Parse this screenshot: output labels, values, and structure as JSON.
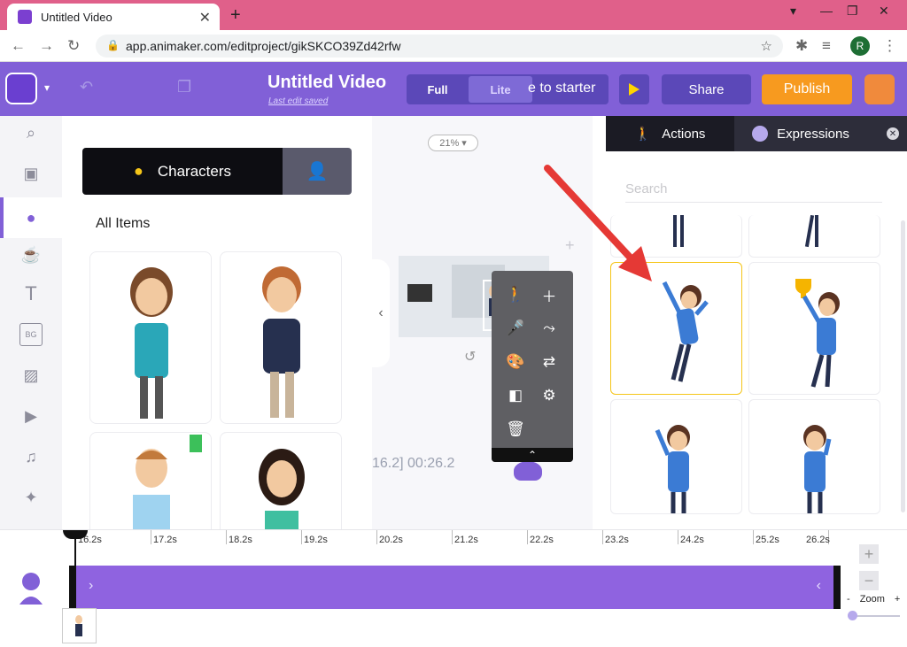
{
  "browser": {
    "tab_title": "Untitled Video",
    "url": "app.animaker.com/editproject/gikSKCO39Zd42rfw",
    "profile_initial": "R"
  },
  "header": {
    "title": "Untitled Video",
    "subtitle": "Last edit saved",
    "mode_full": "Full",
    "mode_lite": "Lite",
    "switch_to_starter": "e to starter",
    "share": "Share",
    "publish": "Publish"
  },
  "library": {
    "tab_label": "Characters",
    "section_title": "All Items"
  },
  "canvas": {
    "zoom": "21% ▾",
    "timestamp": "16.2]  00:26.2"
  },
  "right_panel": {
    "tab_actions": "Actions",
    "tab_expressions": "Expressions",
    "search_placeholder": "Search"
  },
  "timeline": {
    "ticks": [
      "16.2s",
      "17.2s",
      "18.2s",
      "19.2s",
      "20.2s",
      "21.2s",
      "22.2s",
      "23.2s",
      "24.2s",
      "25.2s",
      "26.2s"
    ],
    "zoom_label": "Zoom",
    "zoom_minus": "-",
    "zoom_plus": "+"
  },
  "colors": {
    "accent": "#8160d7",
    "publish": "#f79a1f",
    "annotation_arrow": "#e53935",
    "selected_card_border": "#f5c518"
  }
}
